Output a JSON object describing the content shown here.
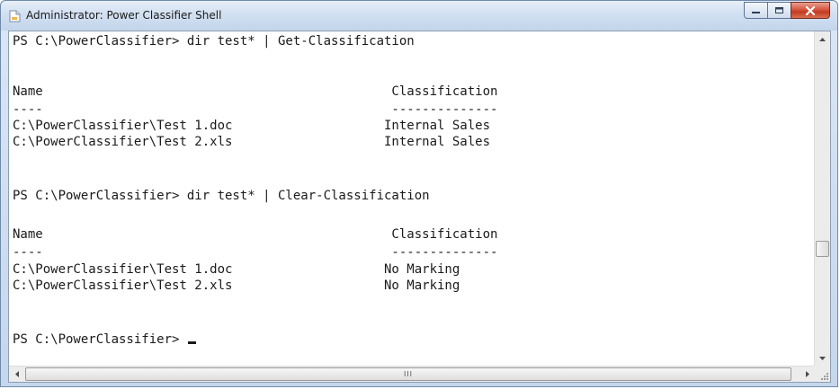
{
  "window": {
    "title": "Administrator: Power Classifier Shell",
    "icon": "console-icon"
  },
  "titlebar_buttons": {
    "minimize_icon": "minimize-icon",
    "maximize_icon": "maximize-icon",
    "close_icon": "close-icon"
  },
  "console": {
    "lines": [
      "PS C:\\PowerClassifier> dir test* | Get-Classification",
      "",
      "Name                                              Classification",
      "----                                              --------------",
      "C:\\PowerClassifier\\Test 1.doc                    Internal Sales",
      "C:\\PowerClassifier\\Test 2.xls                    Internal Sales",
      "",
      "",
      "PS C:\\PowerClassifier> dir test* | Clear-Classification",
      "",
      "Name                                              Classification",
      "----                                              --------------",
      "C:\\PowerClassifier\\Test 1.doc                    No Marking",
      "C:\\PowerClassifier\\Test 2.xls                    No Marking",
      "",
      "",
      "PS C:\\PowerClassifier> "
    ]
  },
  "scrollbars": {
    "vertical": {
      "up_icon": "scroll-up-arrow-icon",
      "down_icon": "scroll-down-arrow-icon"
    },
    "horizontal": {
      "left_icon": "scroll-left-arrow-icon",
      "right_icon": "scroll-right-arrow-icon",
      "grip": "III"
    }
  }
}
